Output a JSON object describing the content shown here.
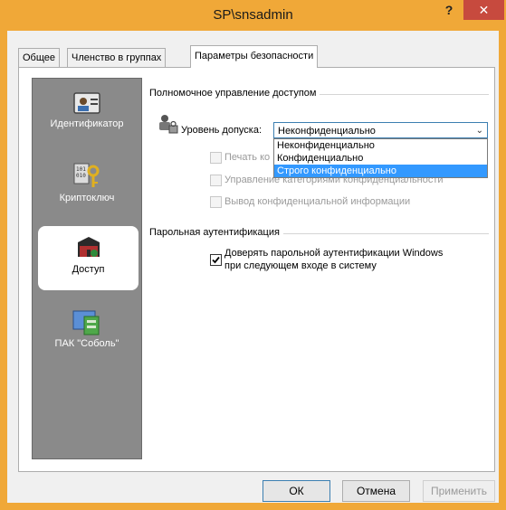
{
  "window": {
    "title": "SP\\snsadmin",
    "help_label": "?",
    "close_label": "✕"
  },
  "tabs": [
    {
      "label": "Общее"
    },
    {
      "label": "Членство в группах"
    },
    {
      "label": "Параметры безопасности"
    }
  ],
  "sidebar": {
    "items": [
      {
        "label": "Идентификатор",
        "icon": "id-card-icon"
      },
      {
        "label": "Криптоключ",
        "icon": "crypto-key-icon"
      },
      {
        "label": "Доступ",
        "icon": "access-icon"
      },
      {
        "label": "ПАК \"Соболь\"",
        "icon": "sobol-icon"
      }
    ],
    "active": "Доступ"
  },
  "access": {
    "section_title": "Полномочное управление доступом",
    "level_label": "Уровень допуска:",
    "level_value": "Неконфиденциально",
    "options": [
      "Неконфиденциально",
      "Конфиденциально",
      "Строго конфиденциально"
    ],
    "selected_option": "Строго конфиденциально",
    "checkboxes": [
      {
        "label": "Печать ко",
        "checked": false,
        "enabled": false
      },
      {
        "label": "Управление категориями конфиденциальности",
        "checked": false,
        "enabled": false
      },
      {
        "label": "Вывод конфиденциальной информации",
        "checked": false,
        "enabled": false
      }
    ]
  },
  "password": {
    "section_title": "Парольная аутентификация",
    "trust_label_line1": "Доверять парольной аутентификации Windows",
    "trust_label_line2": "при следующем входе в систему",
    "trust_checked": true
  },
  "buttons": {
    "ok": "ОК",
    "cancel": "Отмена",
    "apply": "Применить"
  }
}
